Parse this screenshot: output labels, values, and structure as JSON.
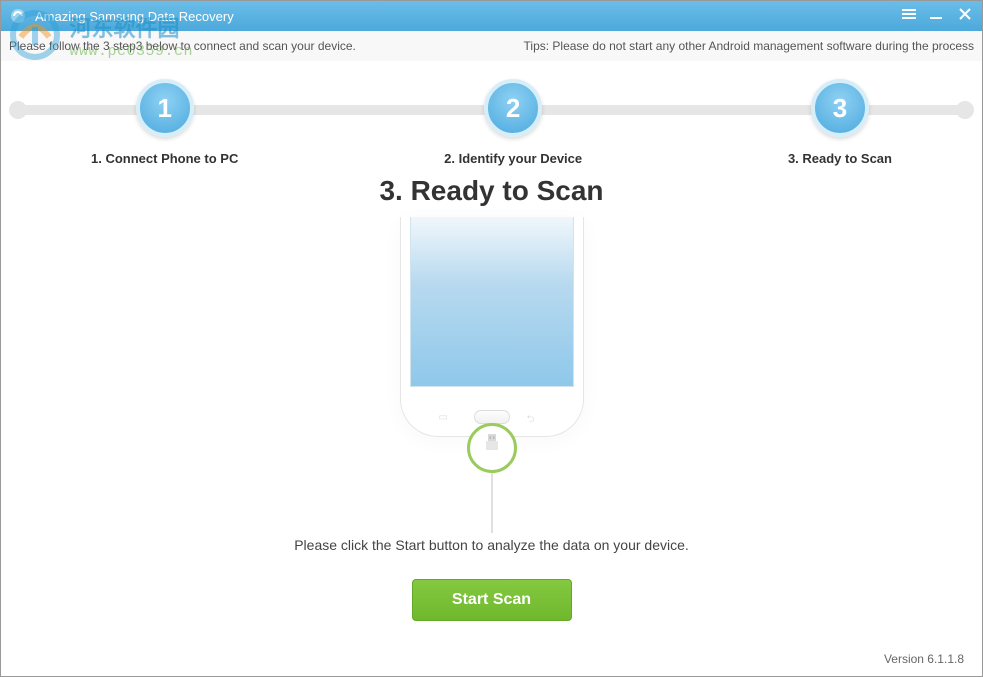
{
  "titlebar": {
    "title": "Amazing Samsung Data Recovery"
  },
  "subheader": {
    "instruction": "Please follow the 3 step3 below to connect and scan your device.",
    "tips": "Tips: Please do not start any other Android management software during the process"
  },
  "steps": [
    {
      "num": "1",
      "label": "1. Connect Phone to PC"
    },
    {
      "num": "2",
      "label": "2. Identify your Device"
    },
    {
      "num": "3",
      "label": "3. Ready to Scan"
    }
  ],
  "main": {
    "heading": "3. Ready to Scan",
    "prompt": "Please click the Start button to analyze the data on your device.",
    "scan_button": "Start Scan"
  },
  "footer": {
    "version": "Version 6.1.1.8"
  },
  "watermark": {
    "cn": "河东软件园",
    "url": "www.pc0359.cn"
  }
}
